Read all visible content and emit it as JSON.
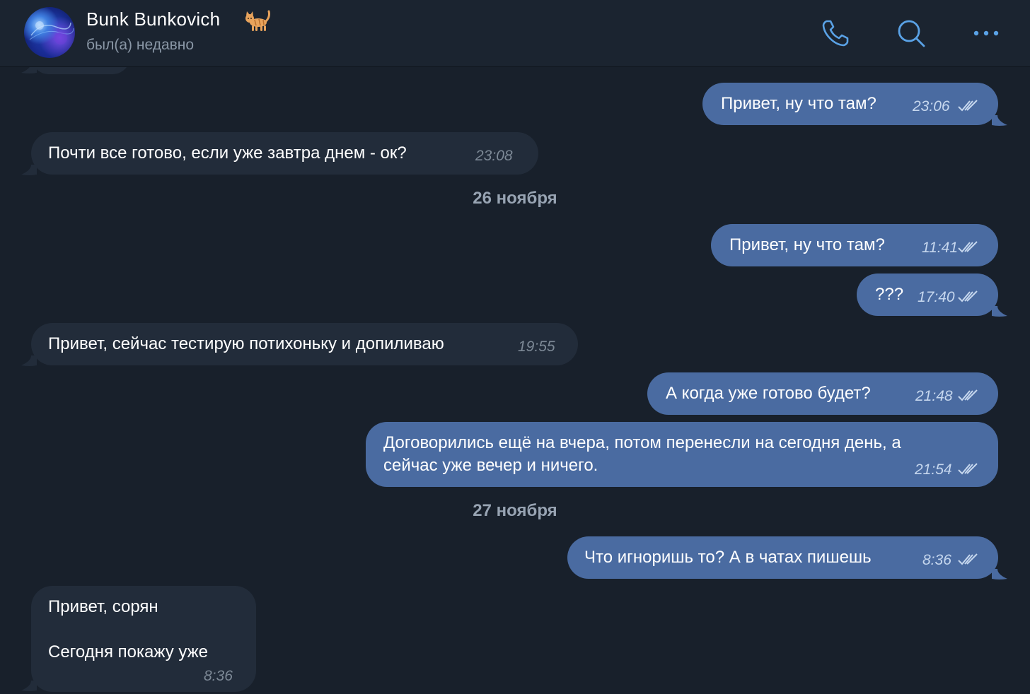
{
  "header": {
    "contact_name": "Bunk Bunkovich",
    "status": "был(а) недавно",
    "emoji": "cat-emoji",
    "buttons": {
      "call_icon": "phone-icon",
      "search_icon": "search-icon",
      "more_icon": "more-dots-icon"
    }
  },
  "colors": {
    "background": "#18202b",
    "header_bg": "#1b2430",
    "incoming_bubble": "#222c3a",
    "outgoing_bubble": "#4a6ba1",
    "accent_icon": "#5aa2e6",
    "date_separator_text": "#97a3b2"
  },
  "messages": [
    {
      "id": "m1",
      "direction": "out",
      "text": "Привет, ну что там?",
      "time": "23:06",
      "read": true
    },
    {
      "id": "m2",
      "direction": "in",
      "text": "Почти все готово, если уже завтра днем - ок?",
      "time": "23:08"
    },
    {
      "id": "d1",
      "type": "date",
      "text": "26 ноября"
    },
    {
      "id": "m3",
      "direction": "out",
      "text": "Привет, ну что там?",
      "time": "11:41",
      "read": true
    },
    {
      "id": "m4",
      "direction": "out",
      "text": "???",
      "time": "17:40",
      "read": true
    },
    {
      "id": "m5",
      "direction": "in",
      "text": "Привет, сейчас тестирую потихоньку и допиливаю",
      "time": "19:55"
    },
    {
      "id": "m6",
      "direction": "out",
      "text": "А когда уже готово будет?",
      "time": "21:48",
      "read": true
    },
    {
      "id": "m7",
      "direction": "out",
      "lines": [
        "Договорились ещё на вчера, потом перенесли на сегодня день, а",
        "сейчас уже вечер и ничего."
      ],
      "time": "21:54",
      "read": true
    },
    {
      "id": "d2",
      "type": "date",
      "text": "27 ноября"
    },
    {
      "id": "m8",
      "direction": "out",
      "text": "Что игноришь то? А в чатах пишешь",
      "time": "8:36",
      "read": true
    },
    {
      "id": "m9",
      "direction": "in",
      "lines": [
        "Привет, сорян",
        "Сегодня покажу уже"
      ],
      "time": "8:36"
    }
  ]
}
